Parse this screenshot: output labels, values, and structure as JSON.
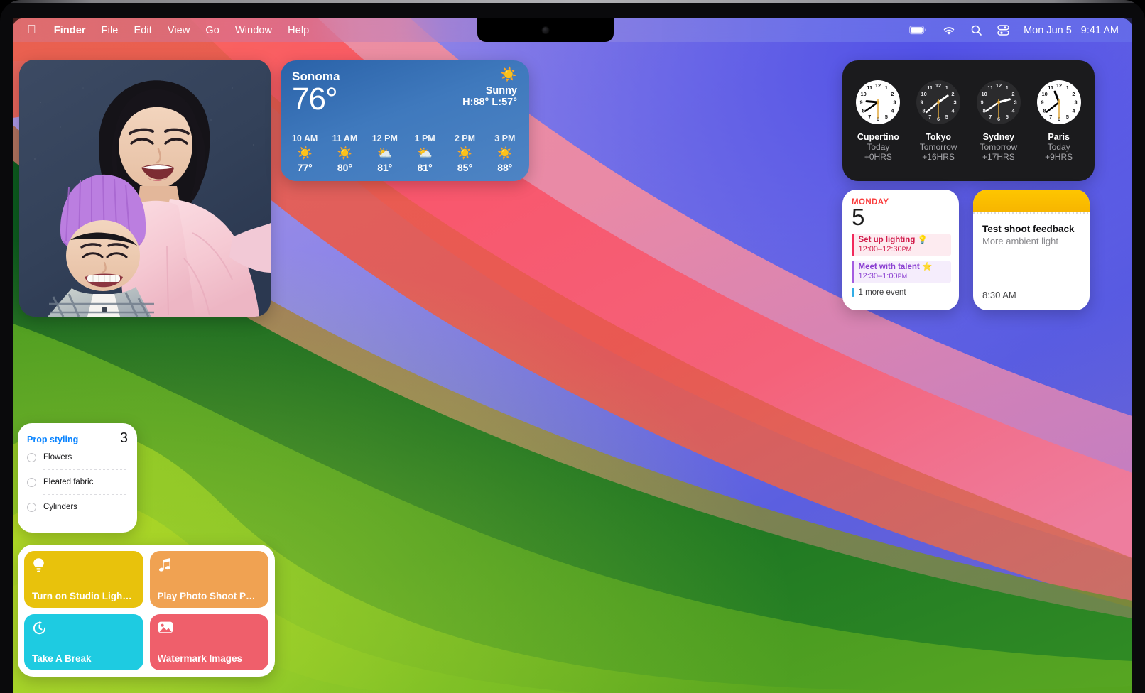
{
  "menubar": {
    "apple_icon": "apple-logo",
    "items": [
      {
        "label": "Finder",
        "bold": true
      },
      {
        "label": "File",
        "bold": false
      },
      {
        "label": "Edit",
        "bold": false
      },
      {
        "label": "View",
        "bold": false
      },
      {
        "label": "Go",
        "bold": false
      },
      {
        "label": "Window",
        "bold": false
      },
      {
        "label": "Help",
        "bold": false
      }
    ],
    "status_icons": [
      "battery-icon",
      "wifi-icon",
      "search-icon",
      "control-center-icon"
    ],
    "date": "Mon Jun 5",
    "time": "9:41 AM"
  },
  "photos_widget": {
    "name": "photos-widget",
    "description": "Selfie photo of a woman and child against a dark navy wall"
  },
  "weather": {
    "city": "Sonoma",
    "temperature": "76°",
    "condition": "Sunny",
    "condition_icon": "sun-icon",
    "high_low": "H:88° L:57°",
    "hourly": [
      {
        "hour": "10 AM",
        "icon": "sun-icon",
        "temp": "77°"
      },
      {
        "hour": "11 AM",
        "icon": "sun-icon",
        "temp": "80°"
      },
      {
        "hour": "12 PM",
        "icon": "sun-behind-cloud-icon",
        "temp": "81°"
      },
      {
        "hour": "1 PM",
        "icon": "sun-behind-cloud-icon",
        "temp": "81°"
      },
      {
        "hour": "2 PM",
        "icon": "sun-icon",
        "temp": "85°"
      },
      {
        "hour": "3 PM",
        "icon": "sun-icon",
        "temp": "88°"
      }
    ]
  },
  "world_clock": {
    "clocks": [
      {
        "city": "Cupertino",
        "day": "Today",
        "offset": "+0HRS",
        "theme": "light",
        "hour_deg": -85,
        "minute_deg": -125,
        "second_deg": 180
      },
      {
        "city": "Tokyo",
        "day": "Tomorrow",
        "offset": "+16HRS",
        "theme": "dark",
        "hour_deg": 55,
        "minute_deg": -130,
        "second_deg": 180
      },
      {
        "city": "Sydney",
        "day": "Tomorrow",
        "offset": "+17HRS",
        "theme": "dark",
        "hour_deg": 75,
        "minute_deg": -125,
        "second_deg": 180
      },
      {
        "city": "Paris",
        "day": "Today",
        "offset": "+9HRS",
        "theme": "light",
        "hour_deg": -22,
        "minute_deg": -128,
        "second_deg": 180
      }
    ],
    "hour_marks": [
      "12",
      "1",
      "2",
      "3",
      "4",
      "5",
      "6",
      "7",
      "8",
      "9",
      "10",
      "11"
    ]
  },
  "calendar": {
    "day_of_week": "MONDAY",
    "day_number": "5",
    "events": [
      {
        "title": "Set up lighting 💡",
        "time": "12:00–12:30",
        "ampm": "PM",
        "bar_color": "#f2295b",
        "bg_color": "#fdebf0",
        "text_color": "#d11b4a"
      },
      {
        "title": "Meet with talent ⭐",
        "time": "12:30–1:00",
        "ampm": "PM",
        "bar_color": "#a45ce0",
        "bg_color": "#f5edfc",
        "text_color": "#8b3fd1"
      }
    ],
    "more_text": "1 more event",
    "more_bar_color": "#32ade6"
  },
  "notes": {
    "title": "Test shoot feedback",
    "subtitle": "More ambient light",
    "time": "8:30 AM",
    "header_color": "#fcc500"
  },
  "reminders": {
    "list_title": "Prop styling",
    "count": "3",
    "items": [
      {
        "label": "Flowers"
      },
      {
        "label": "Pleated fabric"
      },
      {
        "label": "Cylinders"
      }
    ]
  },
  "shortcuts": {
    "tiles": [
      {
        "label": "Turn on Studio Ligh…",
        "icon": "lightbulb-icon",
        "color": "#e8c20c"
      },
      {
        "label": "Play Photo Shoot P…",
        "icon": "music-note-icon",
        "color": "#f0a252"
      },
      {
        "label": "Take A Break",
        "icon": "timer-icon",
        "color": "#1ecbe1"
      },
      {
        "label": "Watermark Images",
        "icon": "photo-icon",
        "color": "#ef5f6b"
      }
    ]
  },
  "theme": {
    "accent_blue": "#0a84ff",
    "menubar_tint_left": "#d87887",
    "menubar_tint_right": "#6c78ee"
  }
}
